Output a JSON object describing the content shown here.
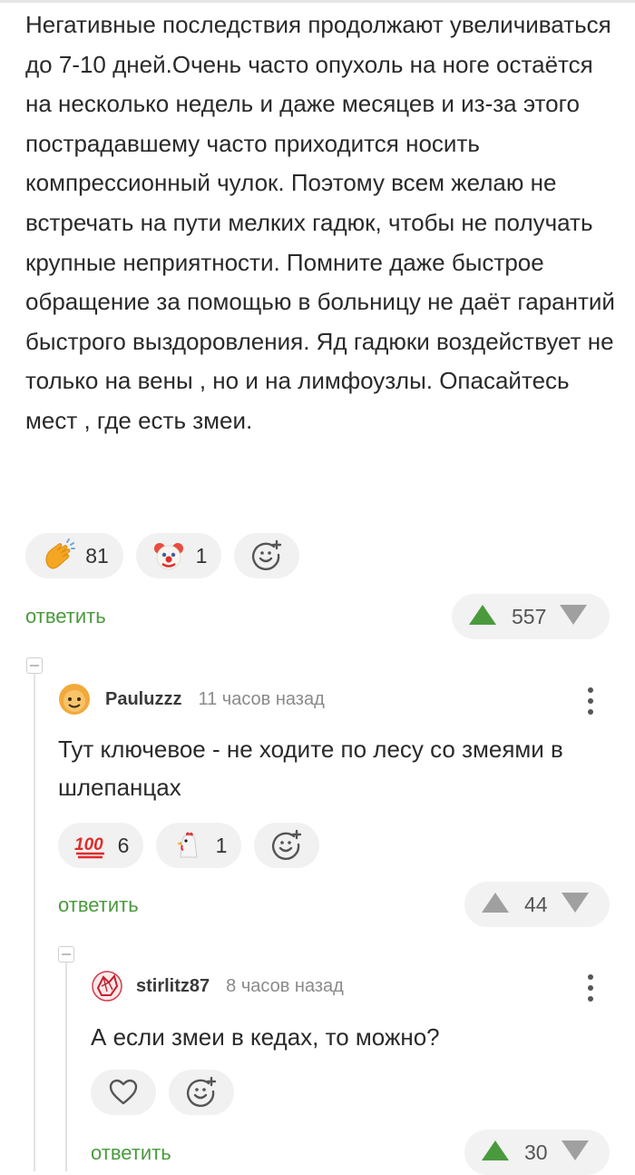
{
  "post": {
    "text": "Негативные последствия продолжают увеличиваться до 7-10 дней.Очень часто опухоль на ноге остаётся на несколько недель и даже месяцев и из-за этого пострадавшему часто приходится носить компрессионный чулок. Поэтому всем желаю не встречать на пути мелких гадюк, чтобы не получать крупные неприятности. Помните даже быстрое обращение за помощью в больницу не даёт гарантий быстрого выздоровления. Яд гадюки воздействует не только на вены , но и на лимфоузлы. Опасайтесь мест , где есть змеи.",
    "reactions": [
      {
        "icon": "clapping-hands-emoji",
        "count": "81"
      },
      {
        "icon": "clown-face-emoji",
        "count": "1"
      }
    ],
    "reply_label": "ответить",
    "rating": "557"
  },
  "comments": [
    {
      "author": "Pauluzzz",
      "time": "11 часов назад",
      "text": "Тут ключевое - не ходите по лесу со змеями в шлепанцах",
      "reactions": [
        {
          "icon": "hundred-points-emoji",
          "count": "6"
        },
        {
          "icon": "chicken-emoji",
          "count": "1"
        }
      ],
      "reply_label": "ответить",
      "rating": "44"
    },
    {
      "author": "stirlitz87",
      "time": "8 часов назад",
      "text": "А если змеи в кедах, то можно?",
      "reply_label": "ответить",
      "rating": "30"
    }
  ],
  "colors": {
    "reply_green": "#4a9a3d",
    "upvote_green": "#4a9a3d",
    "vote_gray": "#a0a0a0",
    "pill_bg": "#f1f1f1"
  }
}
